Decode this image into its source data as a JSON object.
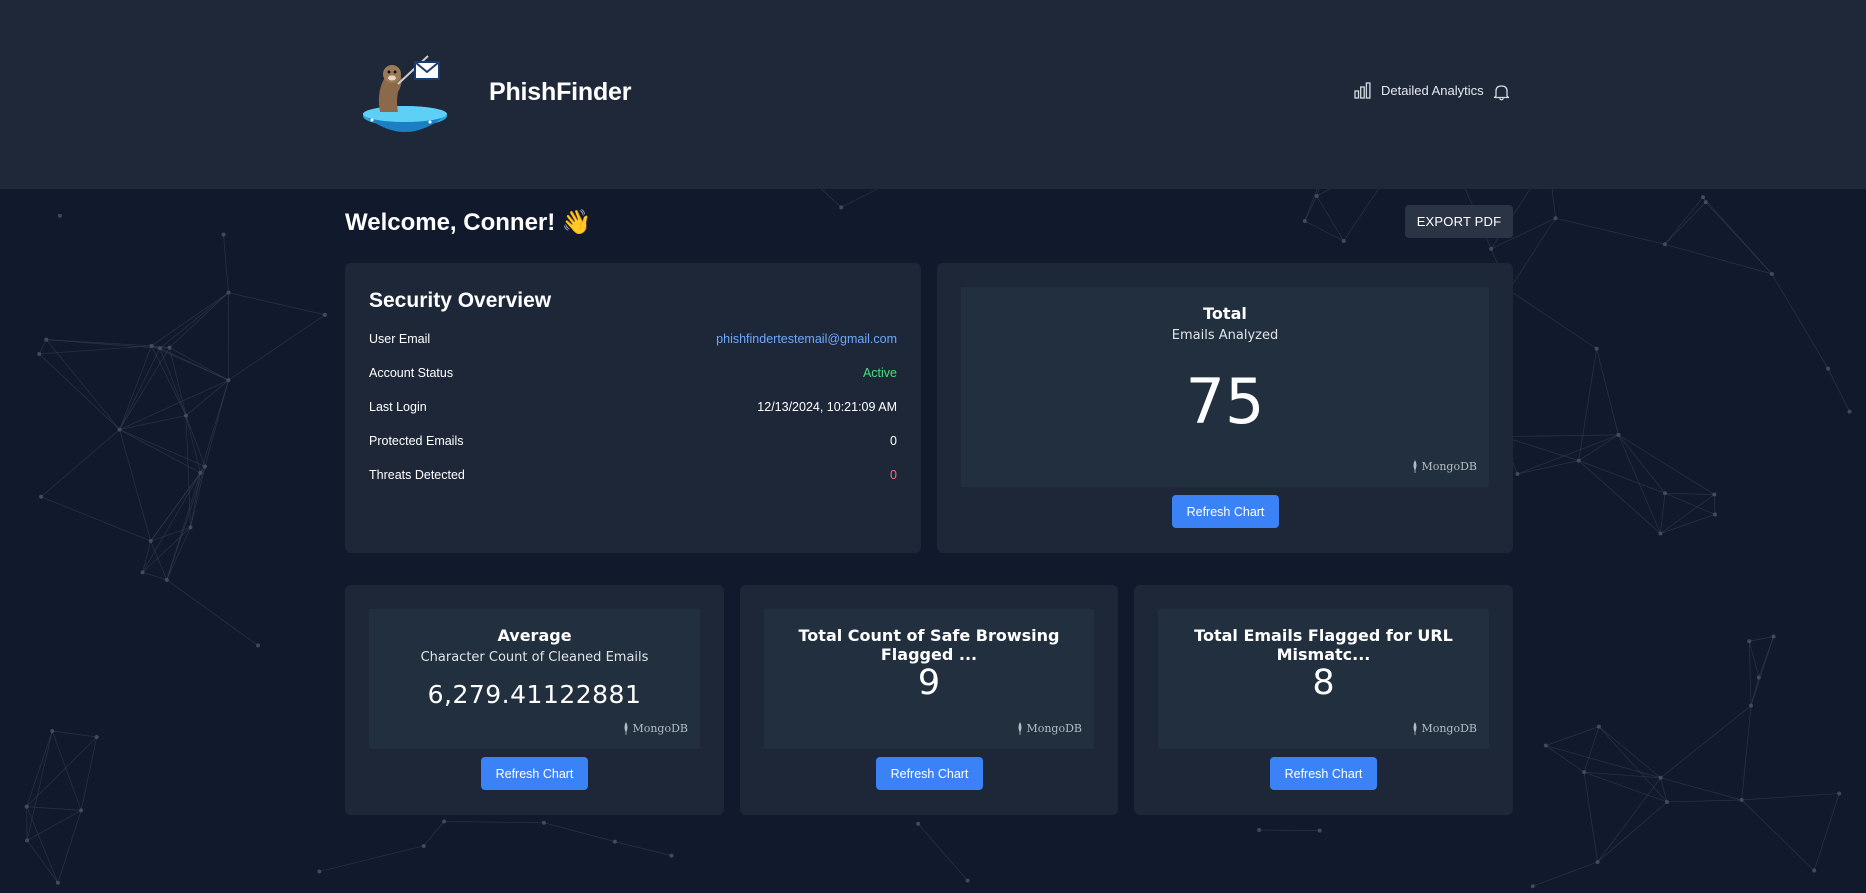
{
  "header": {
    "brand": "PhishFinder",
    "nav_analytics": "Detailed Analytics"
  },
  "welcome": "Welcome, Conner! 👋",
  "export_label": "EXPORT PDF",
  "security": {
    "title": "Security Overview",
    "rows": [
      {
        "label": "User Email",
        "value": "phishfindertestemail@gmail.com"
      },
      {
        "label": "Account Status",
        "value": "Active"
      },
      {
        "label": "Last Login",
        "value": "12/13/2024, 10:21:09 AM"
      },
      {
        "label": "Protected Emails",
        "value": "0"
      },
      {
        "label": "Threats Detected",
        "value": "0"
      }
    ]
  },
  "charts": {
    "total": {
      "title": "Total",
      "subtitle": "Emails Analyzed",
      "value": "75",
      "source": "MongoDB",
      "button": "Refresh Chart"
    },
    "average": {
      "title": "Average",
      "subtitle": "Character Count of Cleaned Emails",
      "value": "6,279.41122881",
      "source": "MongoDB",
      "button": "Refresh Chart"
    },
    "safe_browsing": {
      "title": "Total Count of Safe Browsing Flagged ...",
      "value": "9",
      "source": "MongoDB",
      "button": "Refresh Chart"
    },
    "url_mismatch": {
      "title": "Total Emails Flagged for URL Mismatc...",
      "value": "8",
      "source": "MongoDB",
      "button": "Refresh Chart"
    }
  },
  "colors": {
    "background": "#111a2c",
    "header": "#1f2839",
    "card": "#1e2738",
    "chart_panel": "#222f3e",
    "accent": "#3b82f6",
    "link": "#6ea8fe",
    "success": "#4ade80",
    "danger": "#f87171"
  },
  "icons": [
    "otter-fishing-logo",
    "bar-chart-icon",
    "bell-icon",
    "mongodb-leaf-icon"
  ]
}
